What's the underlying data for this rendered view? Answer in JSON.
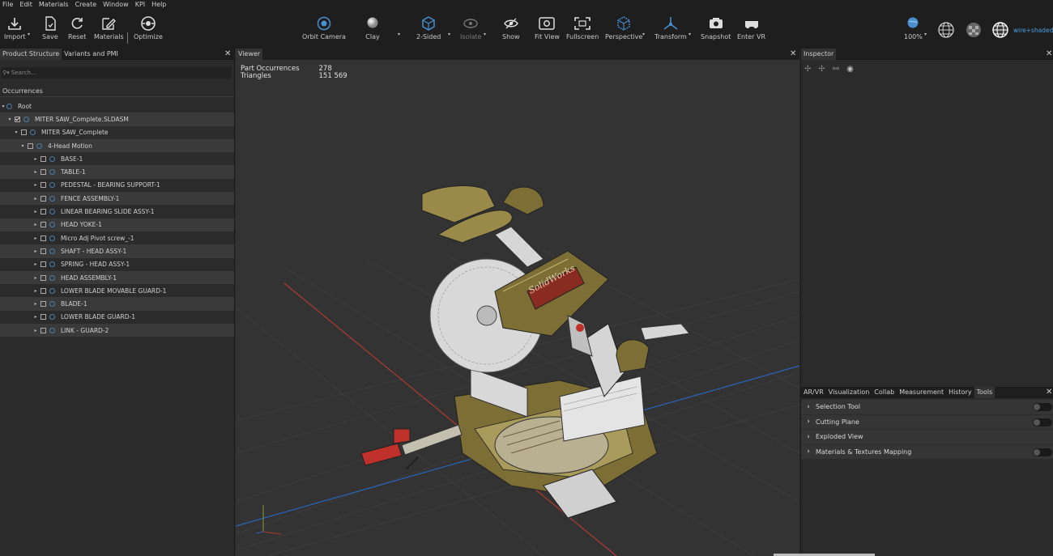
{
  "menu": [
    "File",
    "Edit",
    "Materials",
    "Create",
    "Window",
    "KPI",
    "Help"
  ],
  "toolbar": {
    "import": "Import",
    "save": "Save",
    "reset": "Reset",
    "materials": "Materials",
    "optimize": "Optimize",
    "orbit_camera": "Orbit Camera",
    "clay": "Clay",
    "two_sided": "2-Sided",
    "isolate": "Isolate",
    "show": "Show",
    "fit_view": "Fit View",
    "fullscreen": "Fullscreen",
    "perspective": "Perspective",
    "transform": "Transform",
    "snapshot": "Snapshot",
    "enter_vr": "Enter VR",
    "zoom": "100%",
    "render_mode": "wire+shaded"
  },
  "left_panel": {
    "tabs": [
      "Product Structure",
      "Variants and PMI"
    ],
    "search_placeholder": "▾ Search...",
    "occurrences_header": "Occurrences",
    "tree": [
      {
        "label": "Root",
        "level": 0,
        "checkbox": false
      },
      {
        "label": "MITER SAW_Complete.SLDASM",
        "level": 1,
        "checkbox": true,
        "checked": true
      },
      {
        "label": "MITER SAW_Complete",
        "level": 2,
        "checkbox": true
      },
      {
        "label": "4-Head Motion",
        "level": 3,
        "checkbox": true
      },
      {
        "label": "BASE-1",
        "level": 4,
        "checkbox": true
      },
      {
        "label": "TABLE-1",
        "level": 4,
        "checkbox": true
      },
      {
        "label": "PEDESTAL - BEARING SUPPORT-1",
        "level": 4,
        "checkbox": true
      },
      {
        "label": "FENCE ASSEMBLY-1",
        "level": 4,
        "checkbox": true
      },
      {
        "label": "LINEAR BEARING SLIDE ASSY-1",
        "level": 4,
        "checkbox": true
      },
      {
        "label": "HEAD YOKE-1",
        "level": 4,
        "checkbox": true
      },
      {
        "label": "Micro Adj Pivot screw_-1",
        "level": 4,
        "checkbox": true
      },
      {
        "label": "SHAFT - HEAD ASSY-1",
        "level": 4,
        "checkbox": true
      },
      {
        "label": "SPRING - HEAD ASSY-1",
        "level": 4,
        "checkbox": true
      },
      {
        "label": "HEAD ASSEMBLY-1",
        "level": 4,
        "checkbox": true
      },
      {
        "label": "LOWER BLADE MOVABLE GUARD-1",
        "level": 4,
        "checkbox": true
      },
      {
        "label": "BLADE-1",
        "level": 4,
        "checkbox": true
      },
      {
        "label": "LOWER BLADE GUARD-1",
        "level": 4,
        "checkbox": true
      },
      {
        "label": "LINK - GUARD-2",
        "level": 4,
        "checkbox": true
      }
    ]
  },
  "viewer": {
    "tab": "Viewer",
    "stats": [
      {
        "label": "Part Occurrences",
        "value": "278"
      },
      {
        "label": "Triangles",
        "value": "151 569"
      }
    ],
    "brand_text": "SolidWorks"
  },
  "inspector": {
    "tab": "Inspector"
  },
  "tools_panel": {
    "tabs": [
      "AR/VR",
      "Visualization",
      "Collab",
      "Measurement",
      "History",
      "Tools"
    ],
    "items": [
      {
        "label": "Selection Tool",
        "toggle": true
      },
      {
        "label": "Cutting Plane",
        "toggle": true
      },
      {
        "label": "Exploded View",
        "toggle": false
      },
      {
        "label": "Materials & Textures Mapping",
        "toggle": true
      }
    ]
  },
  "colors": {
    "accent": "#4a8fcf",
    "model_olive": "#8a7a3a",
    "handle_red": "#c0302a"
  }
}
